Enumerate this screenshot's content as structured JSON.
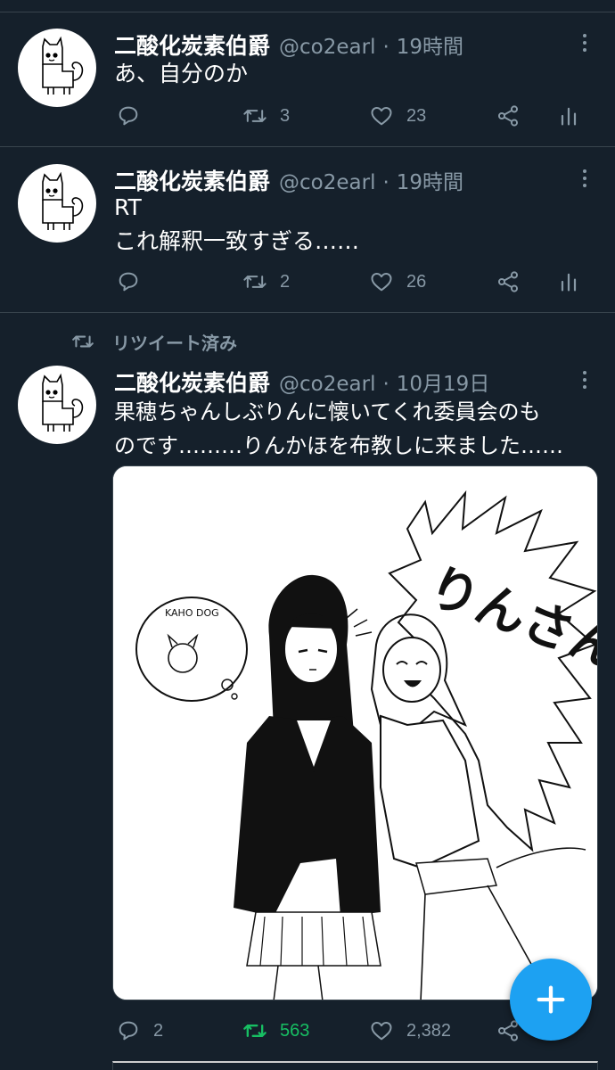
{
  "tweets": [
    {
      "author": {
        "name": "二酸化炭素伯爵",
        "handle": "@co2earl"
      },
      "separator": "·",
      "time": "19時間",
      "text_lines": [
        "あ、自分のか"
      ],
      "counts": {
        "reply": "",
        "retweet": "3",
        "like": "23"
      }
    },
    {
      "author": {
        "name": "二酸化炭素伯爵",
        "handle": "@co2earl"
      },
      "separator": "·",
      "time": "19時間",
      "text_lines": [
        "RT",
        "これ解釈一致すぎる……"
      ],
      "counts": {
        "reply": "",
        "retweet": "2",
        "like": "26"
      }
    },
    {
      "retweet_banner": "リツイート済み",
      "author": {
        "name": "二酸化炭素伯爵",
        "handle": "@co2earl"
      },
      "separator": "·",
      "time": "10月19日",
      "text_lines": [
        "果穂ちゃんしぶりんに懐いてくれ委員会のも",
        "のです………りんかほを布教しに来ました……"
      ],
      "media": {
        "caption_text": [
          "りんさん!!!",
          "KAHO DOG"
        ]
      },
      "counts": {
        "reply": "2",
        "retweet": "563",
        "like": "2,382"
      }
    }
  ],
  "icons": {
    "reply": "reply-icon",
    "retweet": "retweet-icon",
    "like": "heart-icon",
    "share": "share-icon",
    "analytics": "analytics-icon",
    "more": "more-icon",
    "compose": "compose-plus-icon"
  },
  "colors": {
    "background": "#15202b",
    "divider": "#38444d",
    "secondary_text": "#8899a6",
    "retweet_active": "#17bf63",
    "accent": "#1da1f2"
  }
}
